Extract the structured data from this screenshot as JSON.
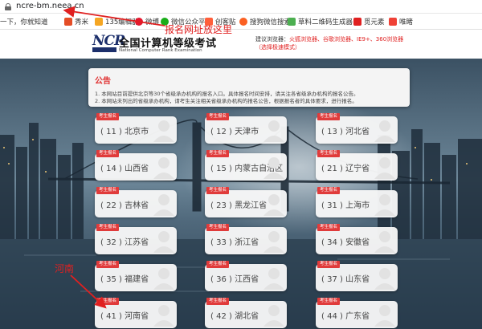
{
  "browser": {
    "url": "ncre-bm.neea.cn",
    "bookmarks": [
      {
        "label": "一下，你就知道",
        "icon": "paw-icon",
        "color": "#2932e1"
      },
      {
        "label": "秀米",
        "icon": "xiumi-icon",
        "color": "#e44d26"
      },
      {
        "label": "135编辑器",
        "icon": "editor-icon",
        "color": "#f5a623"
      },
      {
        "label": "微博",
        "icon": "weibo-icon",
        "color": "#e6162d"
      },
      {
        "label": "微信公众平台",
        "icon": "wechat-icon",
        "color": "#1aad19"
      },
      {
        "label": "创客贴",
        "icon": "chuangketie-icon",
        "color": "#ff5e3a"
      },
      {
        "label": "搜狗微信搜索",
        "icon": "sogou-icon",
        "color": "#fb6022"
      },
      {
        "label": "草料二维码生成器",
        "icon": "qrcode-icon",
        "color": "#4caf50"
      },
      {
        "label": "觅元素",
        "icon": "miyuansu-icon",
        "color": "#e02020"
      },
      {
        "label": "唯睹",
        "icon": "weidu-icon",
        "color": "#ef4136"
      }
    ]
  },
  "header": {
    "logo_text": "NCR",
    "title": "全国计算机等级考试",
    "subtitle": "National Computer Rank Examination",
    "browser_tip": "建议浏览器：",
    "browser_tip_red": "火狐浏览器、谷歌浏览器、IE9+、360浏览器（选择极速模式）"
  },
  "notice": {
    "title": "公告",
    "lines": [
      "1. 本网站目前提供北京等30个省级承办机构的报名入口。具体报名时间安排，请关注各省级承办机构的报名公告。",
      "2. 本网站未列出的省级承办机构，请考生关注相关省级承办机构的报名公告，根据报名者的具体要求，进行报名。"
    ]
  },
  "card_tag": "考生报名",
  "provinces": [
    {
      "label": "( 11 ) 北京市"
    },
    {
      "label": "( 12 ) 天津市"
    },
    {
      "label": "( 13 ) 河北省"
    },
    {
      "label": "( 14 ) 山西省"
    },
    {
      "label": "( 15 ) 内蒙古自治区"
    },
    {
      "label": "( 21 ) 辽宁省"
    },
    {
      "label": "( 22 ) 吉林省"
    },
    {
      "label": "( 23 ) 黑龙江省"
    },
    {
      "label": "( 31 ) 上海市"
    },
    {
      "label": "( 32 ) 江苏省"
    },
    {
      "label": "( 33 ) 浙江省"
    },
    {
      "label": "( 34 ) 安徽省"
    },
    {
      "label": "( 35 ) 福建省"
    },
    {
      "label": "( 36 ) 江西省"
    },
    {
      "label": "( 37 ) 山东省"
    },
    {
      "label": "( 41 ) 河南省"
    },
    {
      "label": "( 42 ) 湖北省"
    },
    {
      "label": "( 44 ) 广东省"
    }
  ],
  "annotations": {
    "url_note": "报名网址放这里",
    "henan_note": "河南"
  }
}
